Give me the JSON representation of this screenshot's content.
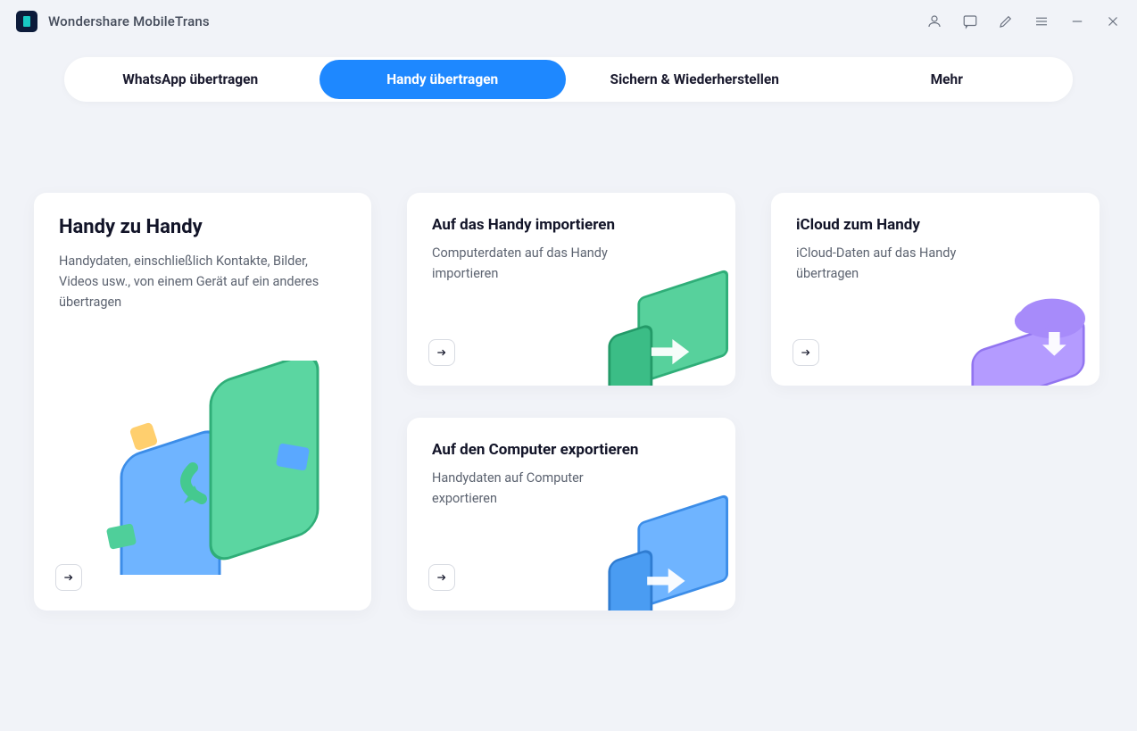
{
  "app": {
    "title": "Wondershare MobileTrans"
  },
  "nav": {
    "tabs": [
      {
        "label": "WhatsApp übertragen",
        "active": false
      },
      {
        "label": "Handy übertragen",
        "active": true
      },
      {
        "label": "Sichern & Wiederherstellen",
        "active": false
      },
      {
        "label": "Mehr",
        "active": false
      }
    ]
  },
  "cards": {
    "phone_to_phone": {
      "title": "Handy zu Handy",
      "desc": "Handydaten, einschließlich Kontakte, Bilder, Videos usw., von einem Gerät auf ein anderes übertragen"
    },
    "import_to_phone": {
      "title": "Auf das Handy importieren",
      "desc": "Computerdaten auf das Handy importieren"
    },
    "icloud_to_phone": {
      "title": "iCloud zum Handy",
      "desc": "iCloud-Daten auf das Handy übertragen"
    },
    "export_to_computer": {
      "title": "Auf den Computer exportieren",
      "desc": "Handydaten auf Computer exportieren"
    }
  }
}
